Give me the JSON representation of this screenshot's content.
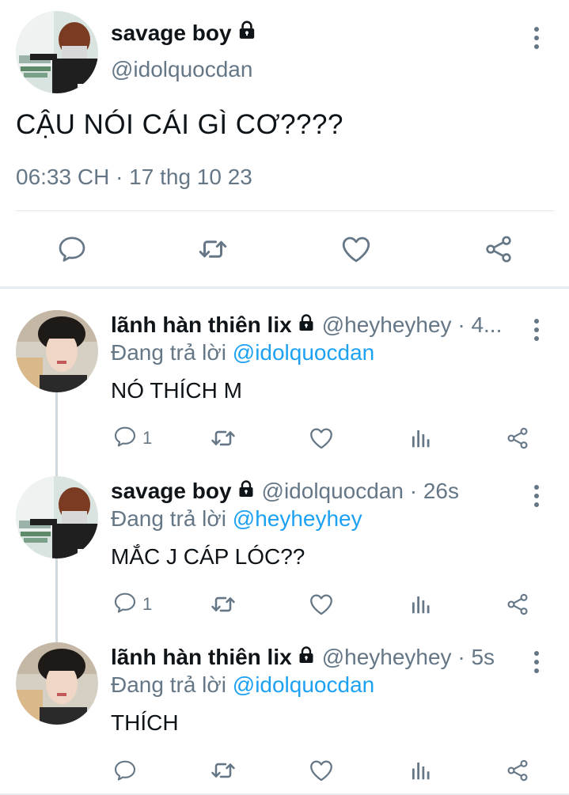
{
  "main_tweet": {
    "display_name": "savage boy",
    "handle": "@idolquocdan",
    "text": "CẬU NÓI CÁI GÌ CƠ????",
    "time": "06:33 CH · 17 thg 10 23",
    "actions": [
      "reply-icon",
      "retweet-icon",
      "like-icon",
      "share-icon"
    ]
  },
  "replies": [
    {
      "display_name": "lãnh hàn thiên lix",
      "handle": "@heyheyhey · 4...",
      "replying_prefix": "Đang trả lời ",
      "replying_to": "@idolquocdan",
      "text": "NÓ THÍCH M",
      "reply_count": "1"
    },
    {
      "display_name": "savage boy",
      "handle": "@idolquocdan · 26s",
      "replying_prefix": "Đang trả lời ",
      "replying_to": "@heyheyhey",
      "text": "MẮC J CÁP LÓC??",
      "reply_count": "1"
    },
    {
      "display_name": "lãnh hàn thiên lix",
      "handle": "@heyheyhey · 5s",
      "replying_prefix": "Đang trả lời ",
      "replying_to": "@idolquocdan",
      "text": "THÍCH",
      "reply_count": ""
    }
  ],
  "colors": {
    "text": "#0f1419",
    "secondary": "#657786",
    "link": "#1da1f2",
    "divider": "#e6ecf0"
  }
}
